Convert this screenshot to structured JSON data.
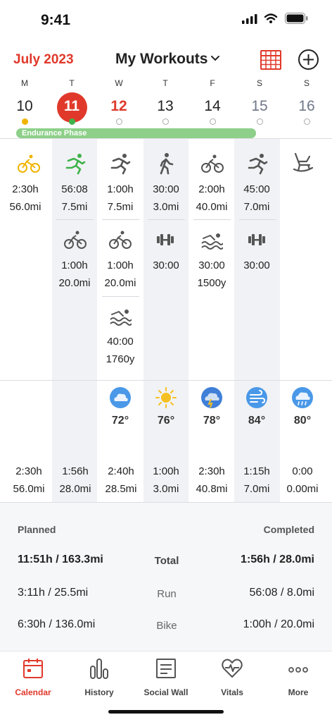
{
  "status": {
    "time": "9:41"
  },
  "header": {
    "month": "July 2023",
    "title": "My Workouts"
  },
  "days": [
    {
      "letter": "M",
      "num": "10"
    },
    {
      "letter": "T",
      "num": "11"
    },
    {
      "letter": "W",
      "num": "12"
    },
    {
      "letter": "T",
      "num": "13"
    },
    {
      "letter": "F",
      "num": "14"
    },
    {
      "letter": "S",
      "num": "15"
    },
    {
      "letter": "S",
      "num": "16"
    }
  ],
  "phase": "Endurance Phase",
  "workouts": {
    "mon": [
      {
        "icon": "bike-icon",
        "v1": "2:30h",
        "v2": "56.0mi"
      }
    ],
    "tue": [
      {
        "icon": "run-icon",
        "v1": "56:08",
        "v2": "7.5mi"
      },
      {
        "icon": "bike-icon",
        "v1": "1:00h",
        "v2": "20.0mi"
      }
    ],
    "wed": [
      {
        "icon": "run-icon",
        "v1": "1:00h",
        "v2": "7.5mi"
      },
      {
        "icon": "bike-icon",
        "v1": "1:00h",
        "v2": "20.0mi"
      },
      {
        "icon": "swim-icon",
        "v1": "40:00",
        "v2": "1760y"
      }
    ],
    "thu": [
      {
        "icon": "walk-icon",
        "v1": "30:00",
        "v2": "3.0mi"
      },
      {
        "icon": "strength-icon",
        "v1": "30:00",
        "v2": ""
      }
    ],
    "fri": [
      {
        "icon": "bike-icon",
        "v1": "2:00h",
        "v2": "40.0mi"
      },
      {
        "icon": "swim-icon",
        "v1": "30:00",
        "v2": "1500y"
      }
    ],
    "sat": [
      {
        "icon": "run-icon",
        "v1": "45:00",
        "v2": "7.0mi"
      },
      {
        "icon": "strength-icon",
        "v1": "30:00",
        "v2": ""
      }
    ],
    "sun": [
      {
        "icon": "rest-icon"
      }
    ]
  },
  "weather": {
    "wed": {
      "icon": "cloud-icon",
      "temp": "72°"
    },
    "thu": {
      "icon": "sun-icon",
      "temp": "76°"
    },
    "fri": {
      "icon": "storm-icon",
      "temp": "78°"
    },
    "sat": {
      "icon": "wind-icon",
      "temp": "84°"
    },
    "sun": {
      "icon": "rain-icon",
      "temp": "80°"
    }
  },
  "totals": [
    {
      "t": "2:30h",
      "d": "56.0mi"
    },
    {
      "t": "1:56h",
      "d": "28.0mi"
    },
    {
      "t": "2:40h",
      "d": "28.5mi"
    },
    {
      "t": "1:00h",
      "d": "3.0mi"
    },
    {
      "t": "2:30h",
      "d": "40.8mi"
    },
    {
      "t": "1:15h",
      "d": "7.0mi"
    },
    {
      "t": "0:00",
      "d": "0.00mi"
    }
  ],
  "summary": {
    "planned_label": "Planned",
    "completed_label": "Completed",
    "rows": [
      {
        "planned": "11:51h / 163.3mi",
        "label": "Total",
        "completed": "1:56h / 28.0mi"
      },
      {
        "planned": "3:11h / 25.5mi",
        "label": "Run",
        "completed": "56:08 / 8.0mi"
      },
      {
        "planned": "6:30h / 136.0mi",
        "label": "Bike",
        "completed": "1:00h / 20.0mi"
      }
    ]
  },
  "tabs": [
    {
      "label": "Calendar"
    },
    {
      "label": "History"
    },
    {
      "label": "Social Wall"
    },
    {
      "label": "Vitals"
    },
    {
      "label": "More"
    }
  ],
  "colors": {
    "accent": "#e0392b",
    "phase": "#8ed08a",
    "done": "#3fb24a",
    "planned_dot": "#f0b400"
  }
}
